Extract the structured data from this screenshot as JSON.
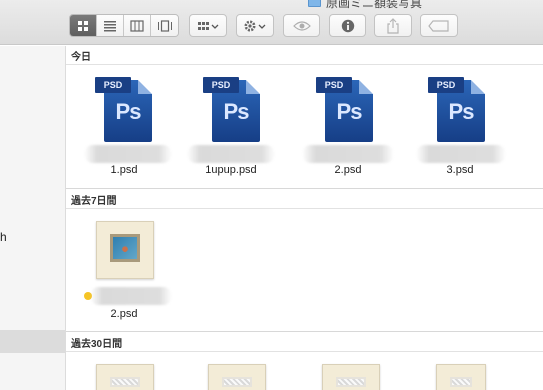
{
  "window": {
    "title": "原画ミニ額装写真"
  },
  "toolbar": {
    "view_modes": [
      {
        "name": "icon-view",
        "active": true
      },
      {
        "name": "list-view",
        "active": false
      },
      {
        "name": "column-view",
        "active": false
      },
      {
        "name": "cover-flow-view",
        "active": false
      }
    ],
    "buttons": [
      {
        "name": "arrange-button",
        "icon": "grid-icon"
      },
      {
        "name": "action-button",
        "icon": "gear-icon"
      },
      {
        "name": "quick-look-button",
        "icon": "eye-icon"
      },
      {
        "name": "get-info-button",
        "icon": "info-icon"
      },
      {
        "name": "share-button",
        "icon": "share-icon"
      },
      {
        "name": "tags-button",
        "icon": "tag-icon"
      }
    ]
  },
  "sidebar": {
    "partial_text": "h"
  },
  "sections": {
    "today": {
      "header": "今日",
      "items": [
        {
          "name": "1.psd",
          "icon_badge": "PSD",
          "icon_glyph": "Ps"
        },
        {
          "name": "1upup.psd",
          "icon_badge": "PSD",
          "icon_glyph": "Ps"
        },
        {
          "name": "2.psd",
          "icon_badge": "PSD",
          "icon_glyph": "Ps"
        },
        {
          "name": "3.psd",
          "icon_badge": "PSD",
          "icon_glyph": "Ps"
        }
      ]
    },
    "past7": {
      "header": "過去7日間",
      "items": [
        {
          "name": "2.psd",
          "tag_color": "#f5c425"
        }
      ]
    },
    "past30": {
      "header": "過去30日間"
    }
  },
  "colors": {
    "accent_tag": "#f5c425",
    "psd_blue": "#1f4f9e"
  }
}
